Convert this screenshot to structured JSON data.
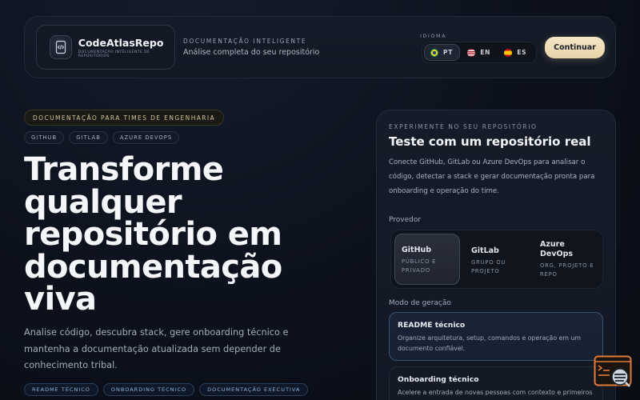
{
  "header": {
    "brand_name": "CodeAtlasRepo",
    "brand_tagline": "DOCUMENTAÇÃO INTELIGENTE DE REPOSITÓRIOS",
    "kicker": "DOCUMENTAÇÃO INTELIGENTE",
    "subtitle": "Análise completa do seu repositório",
    "language_label": "IDIOMA",
    "languages": [
      {
        "code": "PT",
        "flag": "flag-brazil-icon",
        "active": true
      },
      {
        "code": "EN",
        "flag": "flag-usa-icon",
        "active": false
      },
      {
        "code": "ES",
        "flag": "flag-spain-icon",
        "active": false
      }
    ],
    "continue_label": "Continuar"
  },
  "hero": {
    "kicker": "DOCUMENTAÇÃO PARA TIMES DE ENGENHARIA",
    "platforms": [
      "GITHUB",
      "GITLAB",
      "AZURE DEVOPS"
    ],
    "title_lines": [
      "Transforme",
      "qualquer",
      "repositório em",
      "documentação",
      "viva"
    ],
    "description": "Analise código, descubra stack, gere onboarding técnico e mantenha a documentação atualizada sem depender de conhecimento tribal.",
    "tags": [
      "README TÉCNICO",
      "ONBOARDING TÉCNICO",
      "DOCUMENTAÇÃO EXECUTIVA"
    ]
  },
  "card": {
    "kicker": "EXPERIMENTE NO SEU REPOSITÓRIO",
    "title": "Teste com um repositório real",
    "description": "Conecte GitHub, GitLab ou Azure DevOps para analisar o código, detectar a stack e gerar documentação pronta para onboarding e operação do time.",
    "provider_label": "Provedor",
    "providers": [
      {
        "name": "GitHub",
        "description": "PÚBLICO E PRIVADO",
        "active": true
      },
      {
        "name": "GitLab",
        "description": "GRUPO OU PROJETO",
        "active": false
      },
      {
        "name": "Azure DevOps",
        "description": "ORG, PROJETO E REPO",
        "active": false
      }
    ],
    "mode_label": "Modo de geração",
    "modes": [
      {
        "title": "README técnico",
        "description": "Organize arquitetura, setup, comandos e operação em um documento confiável.",
        "active": true
      },
      {
        "title": "Onboarding técnico",
        "description": "Acelere a entrada de novas pessoas com contexto e primeiros passos claros.",
        "active": false
      }
    ]
  },
  "colors": {
    "background": "#0b101a",
    "accent_gold": "#e8d4a8",
    "tag_blue": "#8fb2dd"
  }
}
